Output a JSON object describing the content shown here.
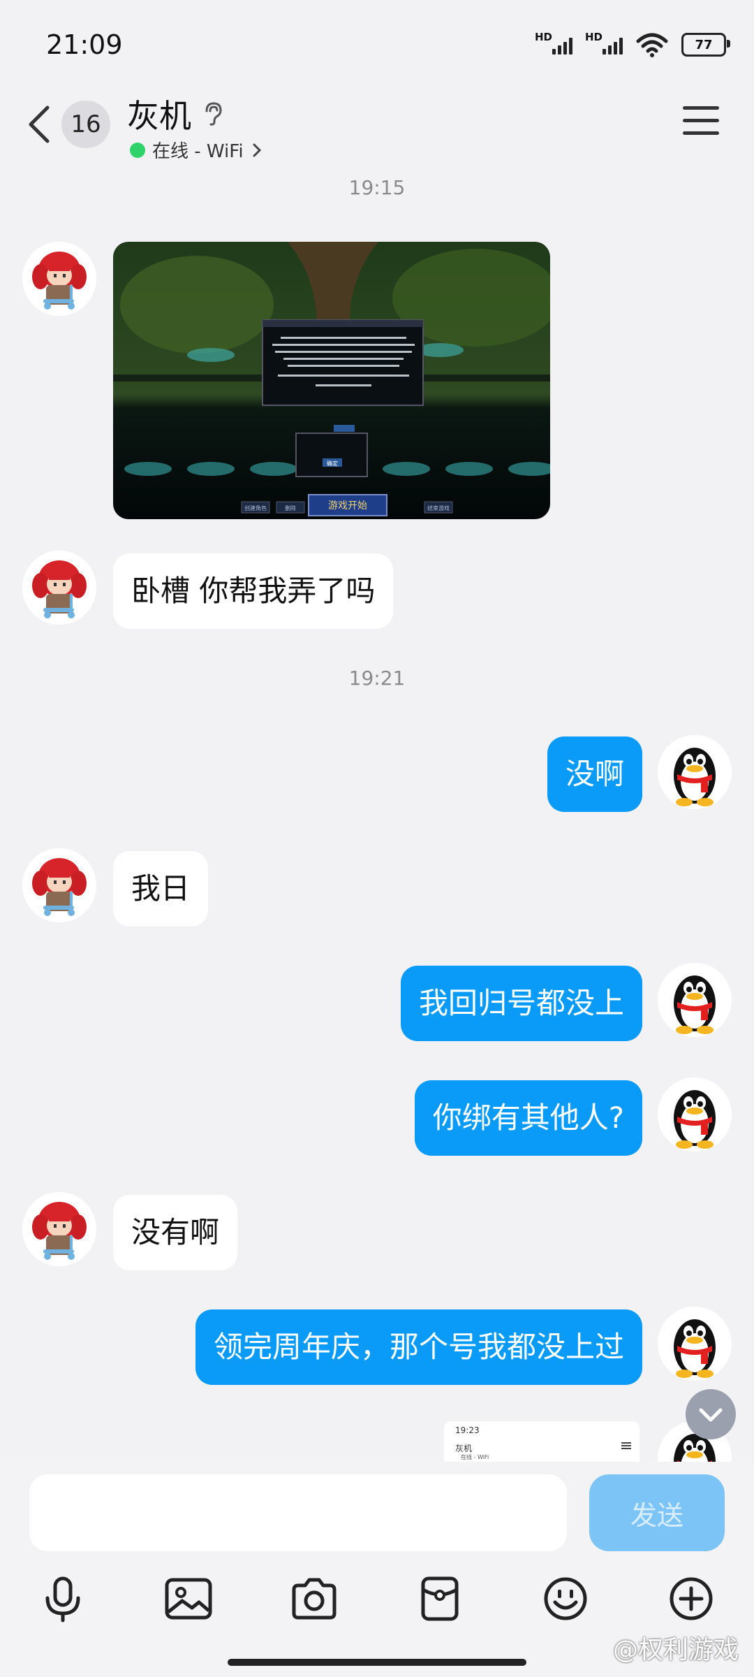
{
  "status_bar": {
    "time": "21:09",
    "battery": "77",
    "hd1": "HD",
    "hd2": "HD"
  },
  "header": {
    "badge_count": "16",
    "contact_name": "灰机",
    "status": "在线 - WiFi"
  },
  "messages": {
    "ts1": "19:15",
    "msg1": "卧槽  你帮我弄了吗",
    "ts2": "19:21",
    "msg2": "没啊",
    "msg3": "我日",
    "msg4": "我回归号都没上",
    "msg5": "你绑有其他人?",
    "msg6": "没有啊",
    "msg7": "领完周年庆，那个号我都没上过"
  },
  "game_image": {
    "start_button": "游戏开始",
    "dialog_button": "确定",
    "small_buttons": [
      "创建角色",
      "删除",
      "结束游戏"
    ]
  },
  "preview": {
    "time": "19:23",
    "name": "灰机",
    "status": "在线 - WiFi"
  },
  "composer": {
    "send_label": "发送"
  },
  "watermark": "@权利游戏",
  "colors": {
    "accent": "#0a9af7",
    "online": "#2fd36a",
    "background": "#f2f2f4"
  }
}
